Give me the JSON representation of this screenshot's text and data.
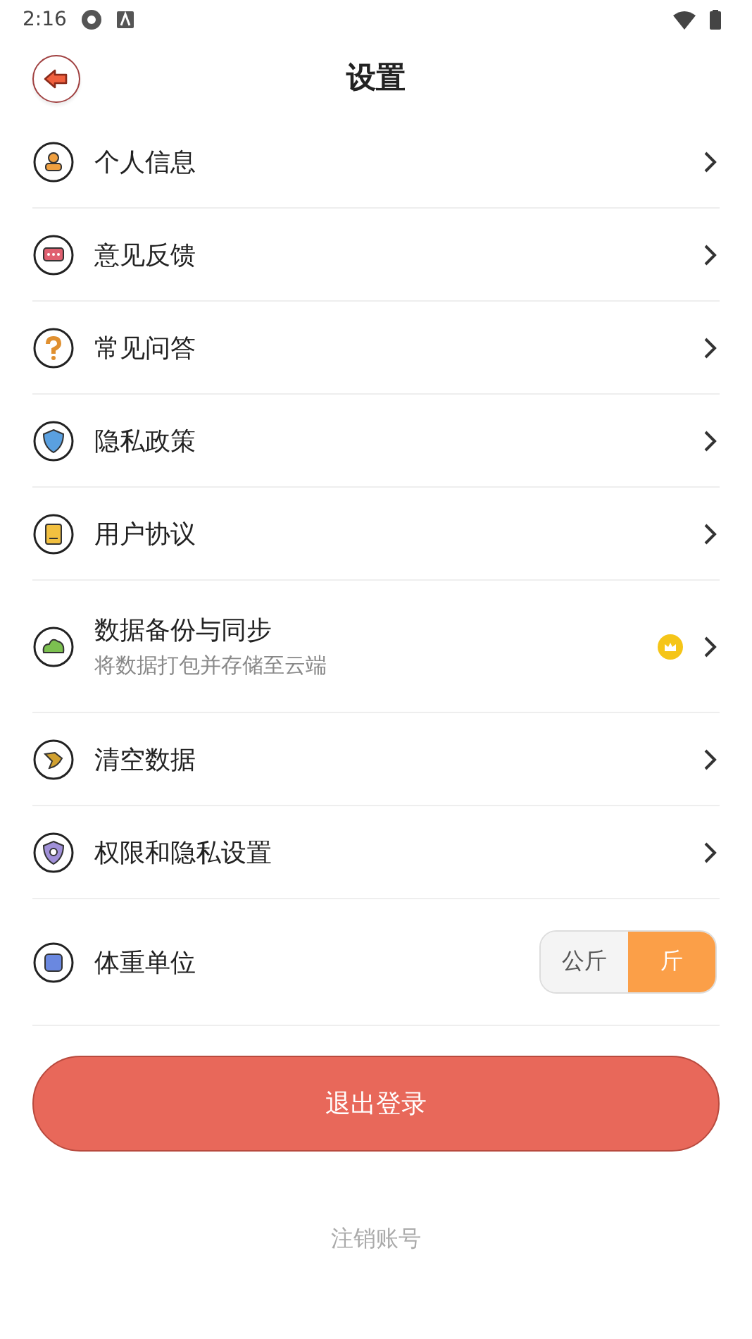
{
  "status_bar": {
    "time": "2:16"
  },
  "header": {
    "title": "设置"
  },
  "items": [
    {
      "kind": "link",
      "label": "个人信息"
    },
    {
      "kind": "link",
      "label": "意见反馈"
    },
    {
      "kind": "link",
      "label": "常见问答"
    },
    {
      "kind": "link",
      "label": "隐私政策"
    },
    {
      "kind": "link",
      "label": "用户协议"
    },
    {
      "kind": "link",
      "label": "数据备份与同步",
      "subtitle": "将数据打包并存储至云端",
      "premium": true
    },
    {
      "kind": "link",
      "label": "清空数据"
    },
    {
      "kind": "link",
      "label": "权限和隐私设置"
    },
    {
      "kind": "unit",
      "label": "体重单位",
      "options": [
        {
          "label": "公斤",
          "selected": false
        },
        {
          "label": "斤",
          "selected": true
        }
      ]
    }
  ],
  "logout_button": "退出登录",
  "delete_account": "注销账号"
}
